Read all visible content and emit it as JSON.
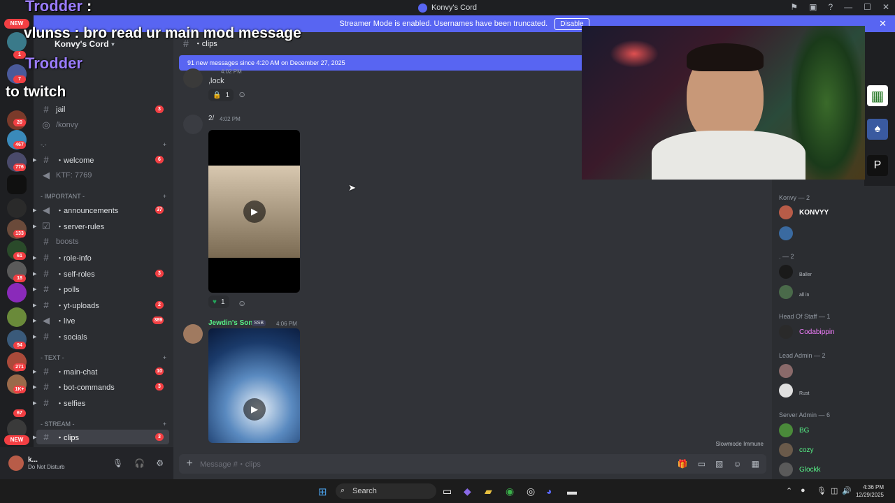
{
  "window": {
    "title": "Konvy's Cord"
  },
  "banner": {
    "text": "Streamer Mode is enabled. Usernames have been truncated.",
    "button": "Disable"
  },
  "overlay": {
    "line1_name": "Trodder",
    "line1_sep": ":",
    "line2": "vlunss : bro read ur main mod message",
    "line3_name": "Trodder",
    "line4": "to twitch"
  },
  "server": {
    "name": "Konvy's Cord"
  },
  "guild_badges": [
    "1",
    "7",
    "20",
    "467",
    "776",
    "133",
    "61",
    "18",
    "94",
    "271",
    "1K+",
    "67"
  ],
  "new_label": "NEW",
  "guild_ss": "SS",
  "channels": {
    "top": [
      {
        "name": "jail",
        "badge": "3",
        "type": "text"
      },
      {
        "name": "/konvy",
        "badge": "",
        "type": "voice"
      }
    ],
    "cat0": {
      "label": "-.-",
      "items": [
        {
          "name": "・welcome",
          "badge": "6",
          "type": "text"
        },
        {
          "name": "KTF: 7769",
          "badge": "",
          "type": "voice"
        }
      ]
    },
    "cat1": {
      "label": "- IMPORTANT -",
      "items": [
        {
          "name": "・announcements",
          "badge": "37",
          "type": "announce"
        },
        {
          "name": "・server-rules",
          "badge": "",
          "type": "rules"
        },
        {
          "name": "boosts",
          "badge": "",
          "type": "text"
        },
        {
          "name": "・role-info",
          "badge": "",
          "type": "text"
        },
        {
          "name": "・self-roles",
          "badge": "3",
          "type": "text"
        },
        {
          "name": "・polls",
          "badge": "",
          "type": "text"
        },
        {
          "name": "・yt-uploads",
          "badge": "2",
          "type": "text"
        },
        {
          "name": "・live",
          "badge": "389",
          "type": "announce"
        },
        {
          "name": "・socials",
          "badge": "",
          "type": "text"
        }
      ]
    },
    "cat2": {
      "label": "- TEXT -",
      "items": [
        {
          "name": "・main-chat",
          "badge": "10",
          "type": "text"
        },
        {
          "name": "・bot-commands",
          "badge": "3",
          "type": "text"
        },
        {
          "name": "・selfies",
          "badge": "",
          "type": "text"
        }
      ]
    },
    "cat3": {
      "label": "- STREAM -",
      "items": [
        {
          "name": "・clips",
          "badge": "3",
          "type": "text"
        }
      ]
    }
  },
  "user": {
    "name": "k...",
    "status": "Do Not Disturb"
  },
  "chat": {
    "channel": "・clips",
    "new_messages": "91 new messages since 4:20 AM on December 27, 2025",
    "messages": [
      {
        "time": "4:02 PM",
        "text": ",lock",
        "reaction": "1"
      },
      {
        "author": "2/",
        "time": "4:02 PM",
        "reaction": "1"
      },
      {
        "author": "Jewdin's Son",
        "tag": "SSB",
        "time": "4:06 PM"
      }
    ],
    "composer_placeholder": "Message #・clips",
    "slowmode": "Slowmode Immune"
  },
  "members": {
    "groups": [
      {
        "title": "Konvy — 2",
        "members": [
          {
            "name": "KONVYY",
            "sub": ""
          },
          {
            "name": "",
            "sub": ""
          }
        ]
      },
      {
        "title": ". — 2",
        "members": [
          {
            "name": "",
            "sub": "Baller"
          },
          {
            "name": "",
            "sub": "all in"
          }
        ]
      },
      {
        "title": "Head Of Staff — 1",
        "members": [
          {
            "name": "Codabippin",
            "sub": ""
          }
        ]
      },
      {
        "title": "Lead Admin — 2",
        "members": [
          {
            "name": "",
            "sub": ""
          },
          {
            "name": "",
            "sub": "Rust"
          }
        ]
      },
      {
        "title": "Server Admin — 6",
        "members": [
          {
            "name": "BG",
            "sub": ""
          },
          {
            "name": "cozy",
            "sub": ""
          },
          {
            "name": "Glockk",
            "sub": ""
          }
        ]
      }
    ]
  },
  "taskbar": {
    "search": "Search",
    "time": "4:36 PM",
    "date": "12/29/2025"
  },
  "colors": {
    "accent": "#5865f2",
    "danger": "#f23f43",
    "green": "#23a55a",
    "member_pink": "#f47fff",
    "member_green": "#57f287"
  }
}
